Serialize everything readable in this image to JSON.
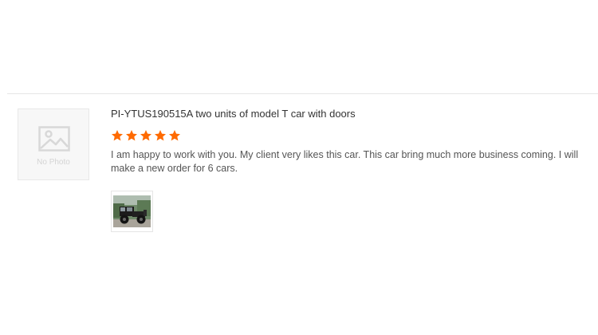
{
  "review": {
    "avatar": {
      "placeholder_label": "No Photo",
      "icon": "image-placeholder-icon"
    },
    "title": "PI-YTUS190515A two units of model T car with doors",
    "rating": {
      "value": 5,
      "max": 5,
      "star_color": "#ff6a00"
    },
    "text": "I am happy to work with you. My client very likes this car. This car bring much more business coming. I will make a new order for 6 cars.",
    "photos": [
      {
        "icon": "vintage-car-photo"
      }
    ]
  }
}
